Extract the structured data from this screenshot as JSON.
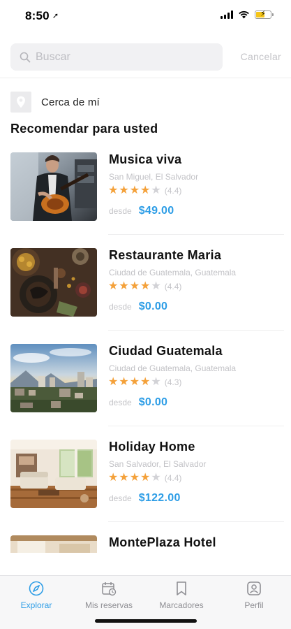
{
  "status_bar": {
    "time": "8:50",
    "location_glyph": "➚"
  },
  "search": {
    "placeholder": "Buscar",
    "value": "",
    "cancel_label": "Cancelar"
  },
  "near_me": {
    "label": "Cerca de mí",
    "icon": "location-pin-icon"
  },
  "section": {
    "title": "Recomendar para usted"
  },
  "listings": [
    {
      "title": "Musica viva",
      "location": "San Miguel, El Salvador",
      "stars": 4,
      "rating": "(4.4)",
      "price_prefix": "desde",
      "price": "$49.00",
      "image": "guitarist-photo"
    },
    {
      "title": "Restaurante Maria",
      "location": "Ciudad de Guatemala, Guatemala",
      "stars": 4,
      "rating": "(4.4)",
      "price_prefix": "desde",
      "price": "$0.00",
      "image": "food-table-photo"
    },
    {
      "title": "Ciudad Guatemala",
      "location": "Ciudad de Guatemala, Guatemala",
      "stars": 4,
      "rating": "(4.3)",
      "price_prefix": "desde",
      "price": "$0.00",
      "image": "city-skyline-photo"
    },
    {
      "title": "Holiday Home",
      "location": "San Salvador, El Salvador",
      "stars": 4,
      "rating": "(4.4)",
      "price_prefix": "desde",
      "price": "$122.00",
      "image": "living-room-photo"
    },
    {
      "title": "MontePlaza Hotel",
      "image": "hotel-room-photo"
    }
  ],
  "tabs": [
    {
      "label": "Explorar",
      "icon": "compass-icon",
      "active": true
    },
    {
      "label": "Mis reservas",
      "icon": "calendar-icon",
      "active": false
    },
    {
      "label": "Marcadores",
      "icon": "bookmark-icon",
      "active": false
    },
    {
      "label": "Perfil",
      "icon": "profile-icon",
      "active": false
    }
  ],
  "colors": {
    "accent": "#2d9de6",
    "star": "#f4a13a",
    "star_empty": "#d2d2d6",
    "muted_text": "#c4c4c8",
    "tab_inactive": "#8e8e93"
  }
}
